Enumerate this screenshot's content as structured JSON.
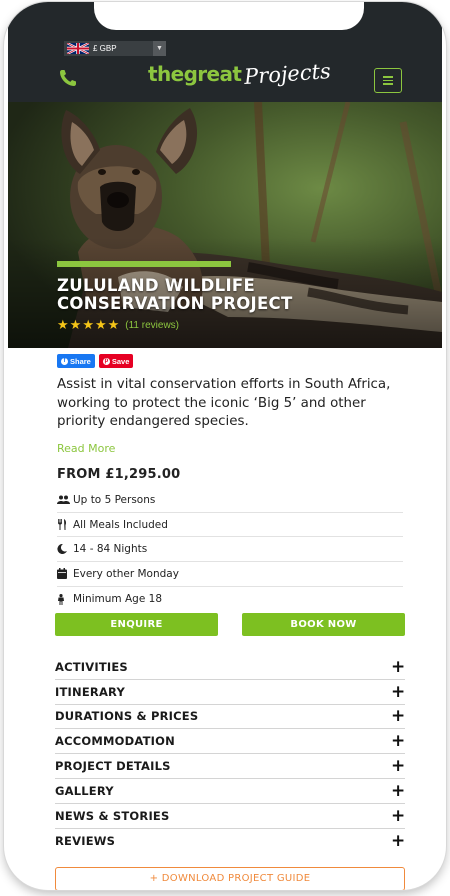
{
  "header": {
    "currency": "£ GBP",
    "logo_the": "thegreat",
    "logo_projects": "Projects"
  },
  "hero": {
    "title": "ZULULAND WILDLIFE CONSERVATION PROJECT",
    "rating": 5,
    "reviews_label": "(11 reviews)"
  },
  "share": {
    "facebook": "Share",
    "pinterest": "Save"
  },
  "intro": "Assist in vital conservation efforts in South Africa, working to protect the iconic ‘Big 5’ and other priority endangered species.",
  "read_more": "Read More",
  "price": "FROM £1,295.00",
  "facts": [
    {
      "icon": "users-icon",
      "text": "Up to 5 Persons"
    },
    {
      "icon": "utensils-icon",
      "text": "All Meals Included"
    },
    {
      "icon": "moon-icon",
      "text": "14 - 84 Nights"
    },
    {
      "icon": "calendar-icon",
      "text": "Every other Monday"
    },
    {
      "icon": "person-icon",
      "text": "Minimum Age 18"
    }
  ],
  "cta": {
    "enquire": "ENQUIRE",
    "book": "BOOK NOW"
  },
  "accordion": [
    {
      "label": "ACTIVITIES"
    },
    {
      "label": "ITINERARY"
    },
    {
      "label": "DURATIONS & PRICES"
    },
    {
      "label": "ACCOMMODATION"
    },
    {
      "label": "PROJECT DETAILS"
    },
    {
      "label": "GALLERY"
    },
    {
      "label": "NEWS & STORIES"
    },
    {
      "label": "REVIEWS"
    }
  ],
  "download": "+ DOWNLOAD PROJECT GUIDE",
  "colors": {
    "accent_green": "#8cc63f",
    "button_green": "#7dc021",
    "header_dark": "#23282b",
    "star": "#f5c518",
    "download_orange": "#f08a3c"
  }
}
